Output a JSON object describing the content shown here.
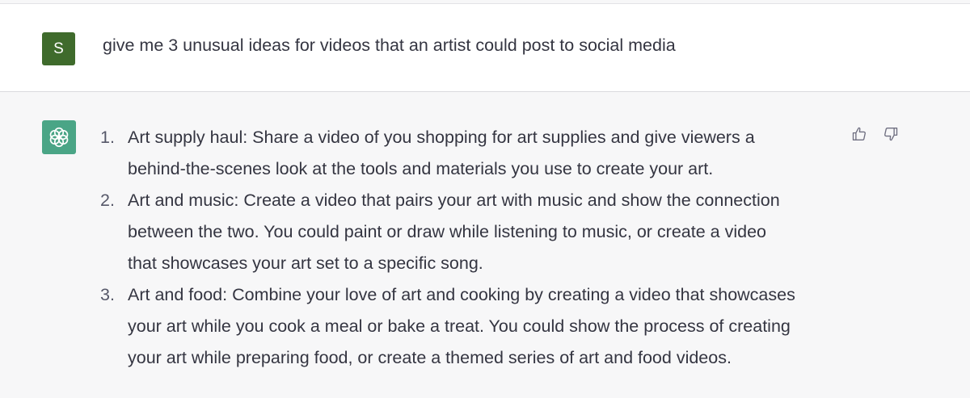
{
  "colors": {
    "user_avatar": "#3f6b2c",
    "assistant_avatar": "#4aa586",
    "text": "#343541",
    "assistant_background": "#f7f7f8",
    "user_background": "#ffffff"
  },
  "user": {
    "avatar_letter": "S",
    "message": "give me 3 unusual ideas for videos that an artist could post to social media"
  },
  "assistant": {
    "avatar_icon": "openai-logo-icon",
    "items": [
      {
        "number": "1.",
        "lines": [
          "Art supply haul: Share a video of you shopping for art supplies and give viewers a",
          "behind-the-scenes look at the tools and materials you use to create your art."
        ]
      },
      {
        "number": "2.",
        "lines": [
          "Art and music: Create a video that pairs your art with music and show the connection",
          "between the two. You could paint or draw while listening to music, or create a video",
          "that showcases your art set to a specific song."
        ]
      },
      {
        "number": "3.",
        "lines": [
          "Art and food: Combine your love of art and cooking by creating a video that showcases",
          "your art while you cook a meal or bake a treat. You could show the process of creating",
          "your art while preparing food, or create a themed series of art and food videos."
        ]
      }
    ],
    "feedback": {
      "like_icon": "thumbs-up-icon",
      "dislike_icon": "thumbs-down-icon"
    }
  }
}
